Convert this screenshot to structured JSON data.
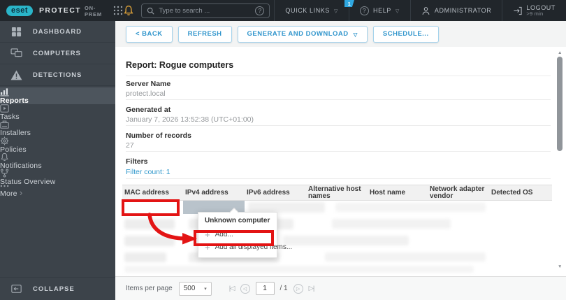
{
  "topbar": {
    "logo_text": "eset",
    "product": "PROTECT",
    "edition": "ON-PREM",
    "search_placeholder": "Type to search ...",
    "quick_links_label": "QUICK LINKS",
    "help_label": "HELP",
    "help_badge": "1",
    "user_label": "ADMINISTRATOR",
    "logout_label": "LOGOUT",
    "logout_sub": ">9 min"
  },
  "sidebar": {
    "items": [
      {
        "label": "DASHBOARD"
      },
      {
        "label": "COMPUTERS"
      },
      {
        "label": "DETECTIONS"
      },
      {
        "label": "Reports",
        "active": true
      },
      {
        "label": "Tasks"
      },
      {
        "label": "Installers"
      },
      {
        "label": "Policies"
      },
      {
        "label": "Notifications"
      },
      {
        "label": "Status Overview"
      },
      {
        "label": "More"
      }
    ],
    "collapse_label": "COLLAPSE"
  },
  "toolbar": {
    "back_label": "< BACK",
    "refresh_label": "REFRESH",
    "generate_label": "GENERATE AND DOWNLOAD",
    "schedule_label": "SCHEDULE..."
  },
  "report": {
    "title": "Report: Rogue computers",
    "fields": [
      {
        "label": "Server Name",
        "value": "protect.local"
      },
      {
        "label": "Generated at",
        "value": "January 7, 2026 13:52:38 (UTC+01:00)"
      },
      {
        "label": "Number of records",
        "value": "27"
      },
      {
        "label": "Filters",
        "value": "Filter count: 1"
      }
    ]
  },
  "table": {
    "columns": [
      "MAC address",
      "IPv4 address",
      "IPv6 address",
      "Alternative host names",
      "Host name",
      "Network adapter vendor",
      "Detected OS"
    ]
  },
  "context_menu": {
    "title": "Unknown computer",
    "items": [
      "Add...",
      "Add all displayed items..."
    ]
  },
  "pagination": {
    "items_per_page_label": "Items per page",
    "items_per_page_value": "500",
    "current_page": "1",
    "of_total": "/ 1"
  },
  "icons": {
    "caret_down": "▽",
    "select_caret": "▾",
    "question": "?",
    "plus": "+",
    "more_chevron": "›",
    "up_arrow": "▲",
    "down_arrow": "▼",
    "first_page": "|◁",
    "prev_page": "◁",
    "next_page": "▷",
    "last_page": "▷|"
  },
  "colors": {
    "brand_cyan": "#2ab5c9",
    "topbar_bg": "#21262b",
    "sidebar_bg": "#3c434a",
    "sidebar_active": "#4d555d",
    "accent_blue": "#3095cc",
    "link_blue": "#3399cc",
    "bell_amber": "#dfa339",
    "badge_blue": "#2fa7e0",
    "annotation_red": "#e31414",
    "selected_cell": "#b9c3cb"
  }
}
